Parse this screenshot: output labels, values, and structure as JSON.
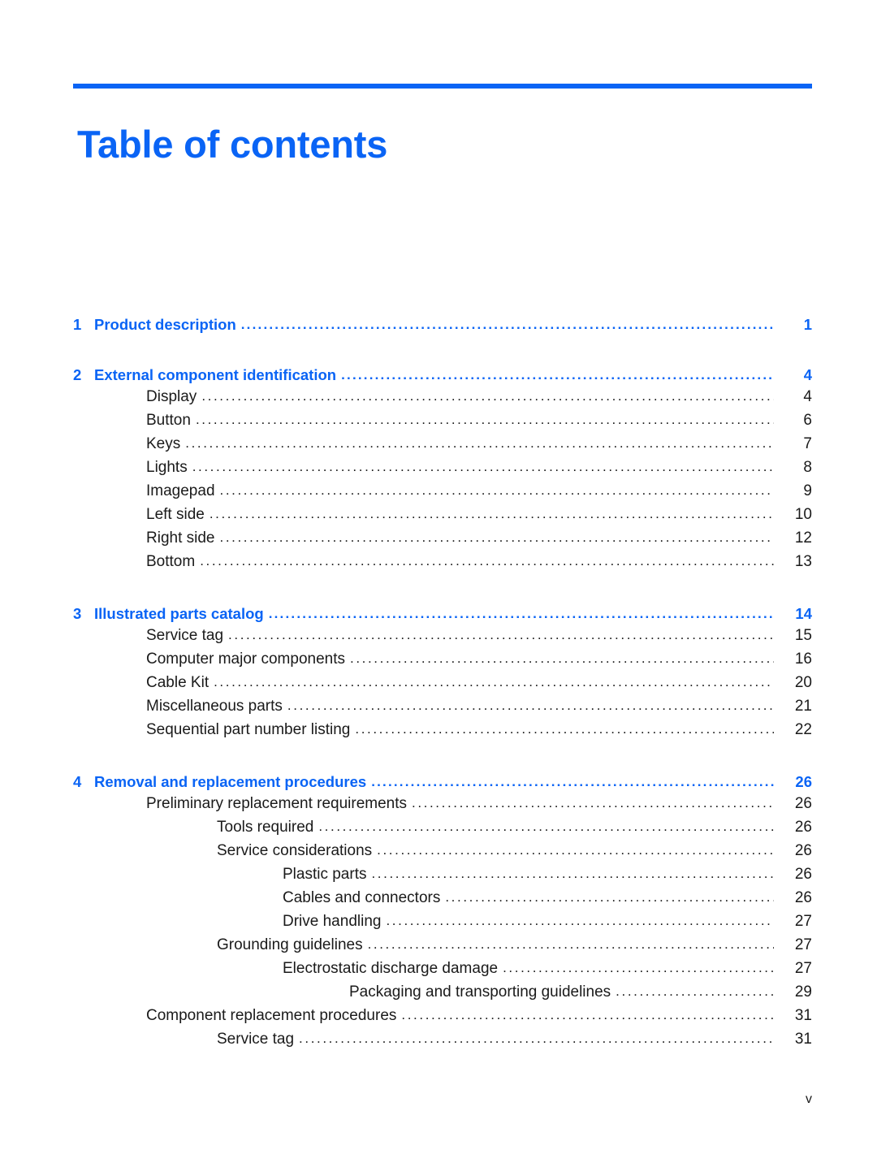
{
  "document": {
    "title": "Table of contents",
    "accent_color": "#0a64f5",
    "text_color": "#1a1a1a",
    "folio": "v"
  },
  "toc": {
    "leader_dots": "..................................................................................................................................................................................................",
    "entries": [
      {
        "level": 0,
        "number": "1",
        "label": "Product description",
        "page": "1"
      },
      {
        "level": 0,
        "number": "2",
        "label": "External component identification",
        "page": "4"
      },
      {
        "level": 1,
        "number": "",
        "label": "Display",
        "page": "4"
      },
      {
        "level": 1,
        "number": "",
        "label": "Button",
        "page": "6"
      },
      {
        "level": 1,
        "number": "",
        "label": "Keys",
        "page": "7"
      },
      {
        "level": 1,
        "number": "",
        "label": "Lights",
        "page": "8"
      },
      {
        "level": 1,
        "number": "",
        "label": "Imagepad",
        "page": "9"
      },
      {
        "level": 1,
        "number": "",
        "label": "Left side",
        "page": "10"
      },
      {
        "level": 1,
        "number": "",
        "label": "Right side",
        "page": "12"
      },
      {
        "level": 1,
        "number": "",
        "label": "Bottom",
        "page": "13"
      },
      {
        "level": 0,
        "number": "3",
        "label": "Illustrated parts catalog",
        "page": "14"
      },
      {
        "level": 1,
        "number": "",
        "label": "Service tag",
        "page": "15"
      },
      {
        "level": 1,
        "number": "",
        "label": "Computer major components",
        "page": "16"
      },
      {
        "level": 1,
        "number": "",
        "label": "Cable Kit",
        "page": "20"
      },
      {
        "level": 1,
        "number": "",
        "label": "Miscellaneous parts",
        "page": "21"
      },
      {
        "level": 1,
        "number": "",
        "label": "Sequential part number listing",
        "page": "22"
      },
      {
        "level": 0,
        "number": "4",
        "label": "Removal and replacement procedures",
        "page": "26"
      },
      {
        "level": 1,
        "number": "",
        "label": "Preliminary replacement requirements",
        "page": "26"
      },
      {
        "level": 2,
        "number": "",
        "label": "Tools required",
        "page": "26"
      },
      {
        "level": 2,
        "number": "",
        "label": "Service considerations",
        "page": "26"
      },
      {
        "level": 3,
        "number": "",
        "label": "Plastic parts",
        "page": "26"
      },
      {
        "level": 3,
        "number": "",
        "label": "Cables and connectors",
        "page": "26"
      },
      {
        "level": 3,
        "number": "",
        "label": "Drive handling",
        "page": "27"
      },
      {
        "level": 2,
        "number": "",
        "label": "Grounding guidelines",
        "page": "27"
      },
      {
        "level": 3,
        "number": "",
        "label": "Electrostatic discharge damage",
        "page": "27"
      },
      {
        "level": 4,
        "number": "",
        "label": "Packaging and transporting guidelines",
        "page": "29"
      },
      {
        "level": 1,
        "number": "",
        "label": "Component replacement procedures",
        "page": "31"
      },
      {
        "level": 2,
        "number": "",
        "label": "Service tag",
        "page": "31"
      }
    ]
  }
}
